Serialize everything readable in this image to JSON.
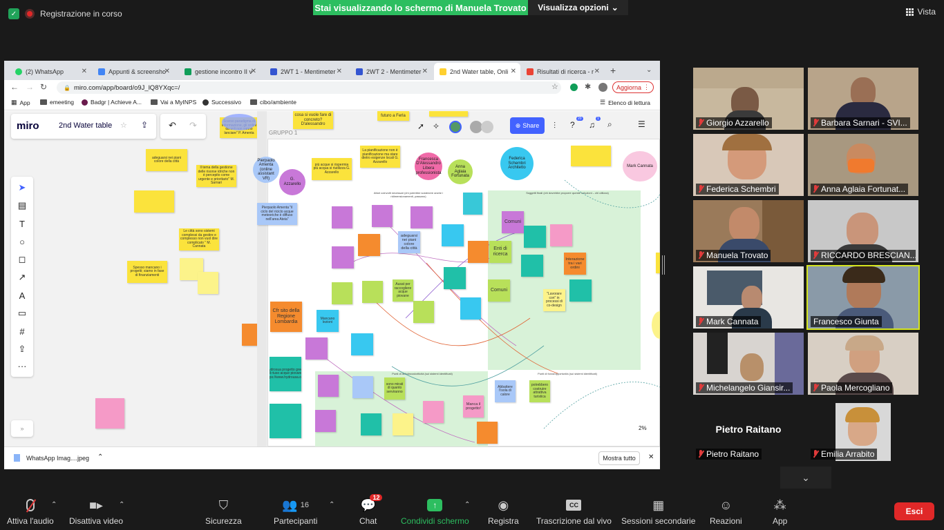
{
  "zoom": {
    "recording": "Registrazione in corso",
    "share_banner": "Stai visualizzando lo schermo di Manuela Trovato",
    "view_options": "Visualizza opzioni",
    "view": "Vista",
    "bottom": {
      "audio": "Attiva l'audio",
      "video": "Disattiva video",
      "security": "Sicurezza",
      "participants": "Partecipanti",
      "participants_count": "16",
      "chat": "Chat",
      "chat_badge": "12",
      "share": "Condividi schermo",
      "record": "Registra",
      "transcript": "Trascrizione dal vivo",
      "breakout": "Sessioni secondarie",
      "reactions": "Reazioni",
      "apps": "App",
      "leave": "Esci"
    },
    "participants": [
      {
        "name": "Giorgio Azzarello"
      },
      {
        "name": "Barbara Sarnari - SVI..."
      },
      {
        "name": "Federica Schembri"
      },
      {
        "name": "Anna Aglaia Fortunat..."
      },
      {
        "name": "Manuela Trovato"
      },
      {
        "name": "RICCARDO BRESCIAN..."
      },
      {
        "name": "Mark Cannata"
      },
      {
        "name": "Francesco Giunta"
      },
      {
        "name": "Michelangelo Giansir..."
      },
      {
        "name": "Paola Mercogliano"
      },
      {
        "name": "Pietro Raitano",
        "label": "Pietro Raitano"
      },
      {
        "name": "Emilia Arrabito"
      }
    ]
  },
  "browser": {
    "tabs": [
      "(2) WhatsApp",
      "Appunti & screensho",
      "gestione incontro II v",
      "2WT 1 - Mentimeter",
      "2WT 2 - Mentimeter",
      "2nd Water table, Onli",
      "Risultati di ricerca - r"
    ],
    "url": "miro.com/app/board/o9J_lQ8YXqc=/",
    "update": "Aggiorna",
    "bookmarks": [
      "App",
      "emeeting",
      "Badgr | Achieve A...",
      "Vai a MyINPS",
      "Successivo",
      "cibo/ambiente"
    ],
    "reading_list": "Elenco di lettura",
    "download_file": "WhatsApp Imag....jpeg",
    "show_all": "Mostra tutto"
  },
  "miro": {
    "logo": "miro",
    "board_name": "2nd Water table",
    "share": "Share",
    "notif_badge": "1",
    "help_badge": "20",
    "zoom": "2%",
    "group_label": "GRUPPO 1",
    "bubbles": [
      "G. Azzarello",
      "Pierpaolo Amenta (online assistant VR)",
      "Francesca D'Alessandro Libera professionista",
      "Anna Aglaia Fortunata",
      "Federica Schembri Architetto",
      "Mark Cannata"
    ],
    "notes": [
      "Comuni",
      "Enti di ricerca",
      "Comuni",
      "Interazione tra i vari ordini",
      "\"Lavorare con\" in processi di co-design",
      "Cfr sito della Regione Lombardia",
      "Mancano lezioni",
      "Hydrosua progetto greco di riuso acque piovane https://www.hydrousa.org/",
      "Ausat per raccogliere acque piovane",
      "Abbattere l'isola di calore",
      "potrebbero costruire attrattiva turistica",
      "Manca il progetto!",
      "Insegnare come funziona l'acqua",
      "sono mirati di quanto serviranno",
      "La pianificazione non è pianificazione ma stare dietro esigenze locali G. Azzarello",
      "più acque si rispermia più acqua si riutilizza G. Azzarello",
      "cosa si vuole fare di concreto? D'alessandro",
      "futuro a Ferla",
      "Pierpaolo Amenta \"il ciclo del riciclo acque meteoriche è diffuso nell'area Ateia\"",
      "Le città sono sistemi complessi da gestire e complesso non vuol dire complicato \" M. Cannata",
      "Spesso mancano i progetti; siamo in fase di finanziamenti",
      "Il tema della gestione delle risorse idriche non è percepito come urgente e prioritario\" M. Sarnari",
      "Scarso paradigma di informazione, gli ordini da soli non sanno lanciare\" P. Amenta",
      "Favorire la condivisione che aggregano partenariati",
      "adeguarsi nei piani colore della città"
    ],
    "col_titles": [
      "Attori coinvolti necessari (chi potrebbe sostenere anche i ridimensionamenti, passano)",
      "Soggetti finali (chi dovrebbe proporre queste soluzioni – chi utilizza)",
      "Punti di debolezza/criticità (sui sistemi identificati)",
      "Punti di forza/opportunità (sui sistemi identificati)"
    ]
  }
}
